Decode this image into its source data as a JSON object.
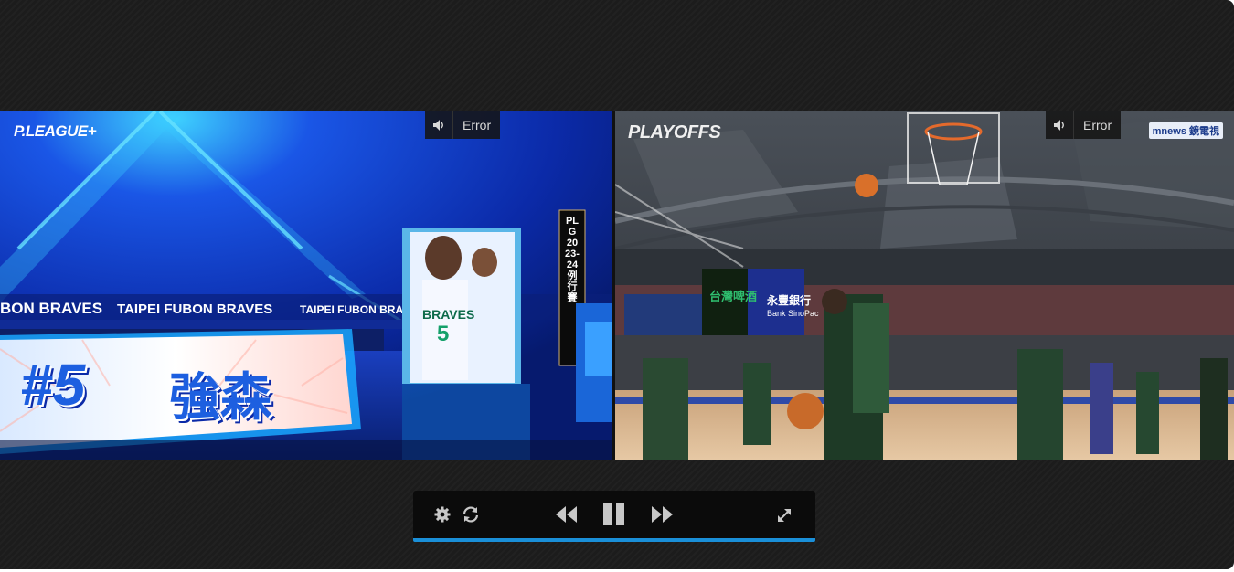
{
  "players": [
    {
      "logo": "P.LEAGUE+",
      "audio_error": "Error",
      "banner_text": "TAIPEI FUBON BRAVES",
      "banner_text_partial": "BON BRAVES",
      "jersey_label": "#5",
      "player_name": "強森",
      "vertical_tag": "PLG 2023-24 例行賽",
      "jersey_team": "BRAVES",
      "jersey_number": "5"
    },
    {
      "logo": "PLAYOFFS",
      "audio_error": "Error",
      "broadcaster": "mnews 鏡電視",
      "sponsor_1": "台灣啤酒",
      "sponsor_2": "永豐銀行",
      "sponsor_2_sub": "Bank SinoPac"
    }
  ],
  "icons": {
    "settings": "gear-icon",
    "sync": "refresh-icon",
    "rewind": "rewind-icon",
    "pause": "pause-icon",
    "forward": "fast-forward-icon",
    "fullscreen": "expand-icon",
    "audio": "speaker-icon"
  },
  "colors": {
    "accent": "#1a8fd8",
    "background": "#1c1c1c"
  }
}
